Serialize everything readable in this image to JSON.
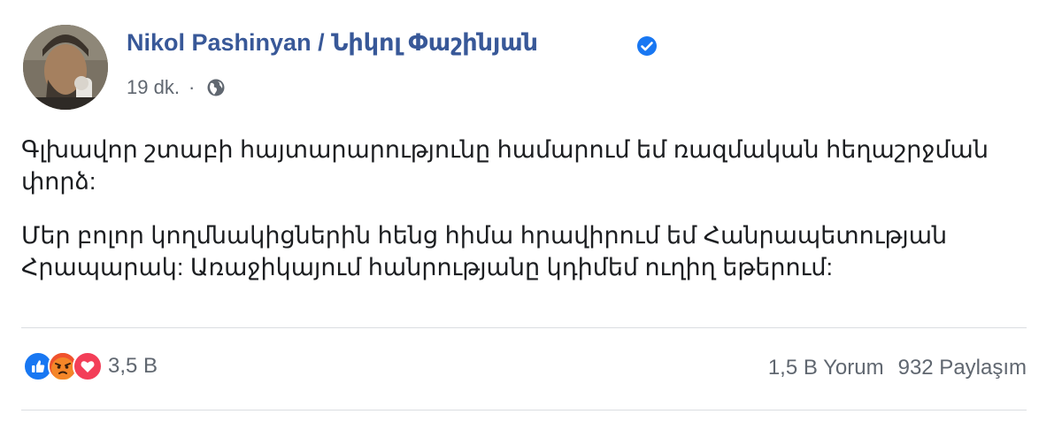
{
  "post": {
    "author": "Nikol Pashinyan / Նիկոլ Փաշինյան",
    "timestamp": "19 dk.",
    "separator": "·",
    "privacy_icon": "globe-icon",
    "verified_icon": "verified-badge-icon",
    "paragraphs": [
      "Գլխավոր շտաբի հայտարարությունը համարում եմ ռազմական հեղաշրջման փորձ:",
      "Մեր բոլոր կողմնակիցներին հենց հիմա հրավիրում եմ Հանրապետության Հրապարակ: Առաջիկայում հանրությանը կդիմեմ ուղիղ եթերում:"
    ]
  },
  "footer": {
    "reaction_icons": [
      "like-icon",
      "angry-icon",
      "love-icon"
    ],
    "reaction_count": "3,5 B",
    "comments": "1,5 B Yorum",
    "shares": "932 Paylaşım"
  },
  "colors": {
    "author": "#385898",
    "secondary_text": "#606770",
    "verified": "#1877f2",
    "like": "#1877f2",
    "angry": "#e9710f",
    "love": "#f33e58",
    "divider": "#dadde1"
  }
}
